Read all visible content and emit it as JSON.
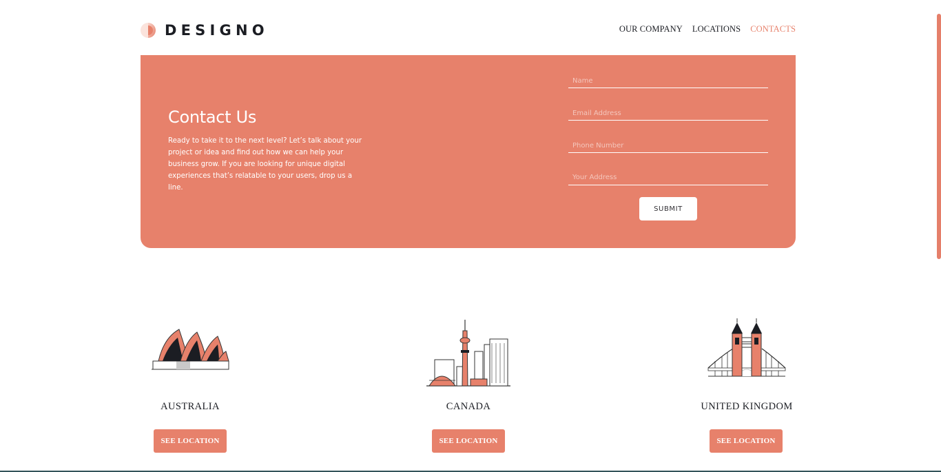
{
  "brand": {
    "name": "DESIGNO",
    "logo_icon": "designo-logo-icon"
  },
  "nav": [
    {
      "label": "OUR COMPANY",
      "active": false
    },
    {
      "label": "LOCATIONS",
      "active": false
    },
    {
      "label": "CONTACTS",
      "active": true
    }
  ],
  "contact": {
    "title": "Contact Us",
    "text": "Ready to take it to the next level? Let’s talk about your project or idea and find out how we can help your business grow. If you are looking for unique digital experiences that’s relatable to your users, drop us a line.",
    "fields": {
      "name": {
        "placeholder": "Name",
        "value": ""
      },
      "email": {
        "placeholder": "Email Address",
        "value": ""
      },
      "phone": {
        "placeholder": "Phone Number",
        "value": ""
      },
      "address": {
        "placeholder": "Your Address",
        "value": ""
      }
    },
    "submit_label": "SUBMIT"
  },
  "locations": [
    {
      "name": "AUSTRALIA",
      "button": "SEE LOCATION",
      "icon": "sydney-opera-house-icon"
    },
    {
      "name": "CANADA",
      "button": "SEE LOCATION",
      "icon": "toronto-skyline-icon"
    },
    {
      "name": "UNITED KINGDOM",
      "button": "SEE LOCATION",
      "icon": "tower-bridge-icon"
    }
  ],
  "colors": {
    "accent": "#e7816b",
    "dark": "#1b1d23",
    "white": "#ffffff"
  }
}
